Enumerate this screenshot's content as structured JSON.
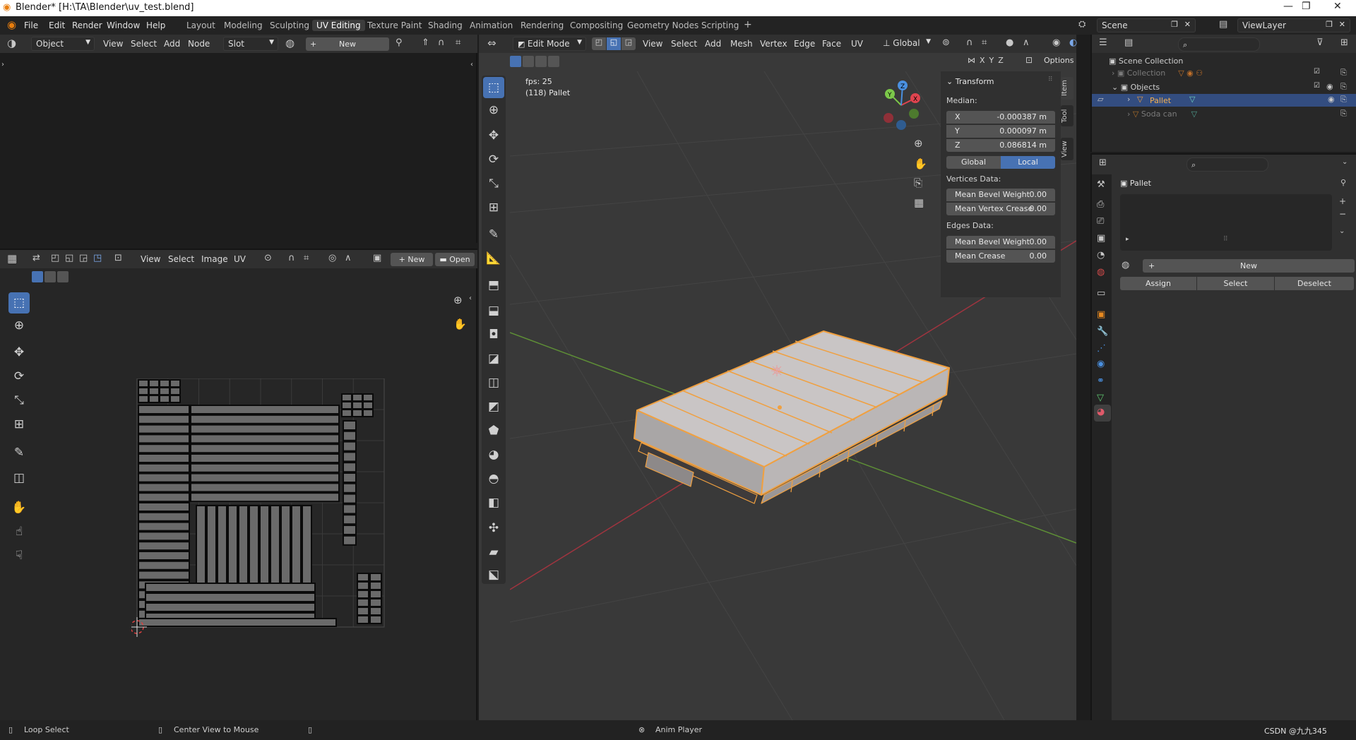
{
  "title_bar": {
    "title": "Blender* [H:\\TA\\Blender\\uv_test.blend]",
    "logo": "blender-logo"
  },
  "menu": [
    "File",
    "Edit",
    "Render",
    "Window",
    "Help"
  ],
  "workspaces": [
    "Layout",
    "Modeling",
    "Sculpting",
    "UV Editing",
    "Texture Paint",
    "Shading",
    "Animation",
    "Rendering",
    "Compositing",
    "Geometry Nodes",
    "Scripting"
  ],
  "active_workspace": "UV Editing",
  "scene": {
    "label": "Scene"
  },
  "view_layer": {
    "label": "ViewLayer"
  },
  "shader_editor": {
    "mode": "Object",
    "menus": [
      "View",
      "Select",
      "Add",
      "Node"
    ],
    "slot": "Slot",
    "new_label": "New"
  },
  "uv_editor": {
    "menus": [
      "View",
      "Select",
      "Image",
      "UV"
    ],
    "new_label": "New",
    "open_label": "Open"
  },
  "viewport": {
    "mode": "Edit Mode",
    "menus": [
      "View",
      "Select",
      "Add",
      "Mesh",
      "Vertex",
      "Edge",
      "Face",
      "UV"
    ],
    "orientation": "Global",
    "options_label": "Options",
    "axes_lock": [
      "X",
      "Y",
      "Z"
    ],
    "fps": "fps: 25",
    "object_info": "(118) Pallet",
    "gizmo": {
      "x": "X",
      "y": "Y",
      "z": "Z"
    }
  },
  "npanel": {
    "section": "Transform",
    "median_label": "Median:",
    "fields": [
      {
        "label": "X",
        "value": "-0.000387 m"
      },
      {
        "label": "Y",
        "value": "0.000097 m"
      },
      {
        "label": "Z",
        "value": "0.086814 m"
      }
    ],
    "space": {
      "global": "Global",
      "local": "Local",
      "active": "Local"
    },
    "vertices_header": "Vertices Data:",
    "vertices": [
      {
        "label": "Mean Bevel Weight",
        "value": "0.00"
      },
      {
        "label": "Mean Vertex Crease",
        "value": "0.00"
      }
    ],
    "edges_header": "Edges Data:",
    "edges": [
      {
        "label": "Mean Bevel Weight",
        "value": "0.00"
      },
      {
        "label": "Mean Crease",
        "value": "0.00"
      }
    ],
    "tabs": [
      "Item",
      "Tool",
      "View"
    ]
  },
  "outliner": {
    "root": "Scene Collection",
    "items": [
      {
        "name": "Collection",
        "dimmed": true
      },
      {
        "name": "Objects",
        "dimmed": false
      },
      {
        "name": "Pallet",
        "selected": true
      },
      {
        "name": "Soda can",
        "dimmed": true
      }
    ]
  },
  "properties": {
    "object_name": "Pallet",
    "new_label": "New",
    "assign_label": "Assign",
    "select_label": "Select",
    "deselect_label": "Deselect"
  },
  "status_bar": {
    "left": "Loop Select",
    "middle": "Center View to Mouse",
    "center": "Anim Player",
    "watermark": "CSDN @九九345"
  },
  "colors": {
    "accent": "#4772b3",
    "selection_orange": "#f0a040",
    "axis_x": "#e0444f",
    "axis_y": "#7cc84a",
    "axis_z": "#4a90e0"
  }
}
